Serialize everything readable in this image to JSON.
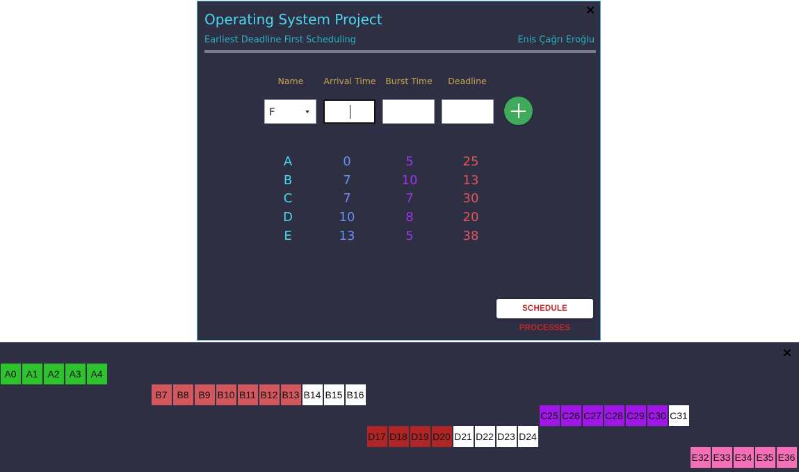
{
  "dialog": {
    "title": "Operating System Project",
    "subtitle": "Earliest Deadline First Scheduling",
    "author": "Enis Çağrı Eroğlu",
    "close_label": "×"
  },
  "form": {
    "headers": {
      "name": "Name",
      "arrival": "Arrival Time",
      "burst": "Burst Time",
      "deadline": "Deadline"
    },
    "name_value": "F",
    "arrival_value": "",
    "burst_value": "",
    "deadline_value": ""
  },
  "processes": [
    {
      "name": "A",
      "arrival": "0",
      "burst": "5",
      "deadline": "25"
    },
    {
      "name": "B",
      "arrival": "7",
      "burst": "10",
      "deadline": "13"
    },
    {
      "name": "C",
      "arrival": "7",
      "burst": "7",
      "deadline": "30"
    },
    {
      "name": "D",
      "arrival": "10",
      "burst": "8",
      "deadline": "20"
    },
    {
      "name": "E",
      "arrival": "13",
      "burst": "5",
      "deadline": "38"
    }
  ],
  "schedule_button": "SCHEDULE PROCESSES",
  "gantt": {
    "close_label": "×",
    "colors": {
      "A": "#2ec32e",
      "B": "#d2575e",
      "C": "#a016e6",
      "D": "#b02525",
      "E": "#f56fb6",
      "missed": "#ffffff"
    },
    "rows": [
      {
        "process": "A",
        "cells": [
          {
            "label": "A0",
            "missed": false
          },
          {
            "label": "A1",
            "missed": false
          },
          {
            "label": "A2",
            "missed": false
          },
          {
            "label": "A3",
            "missed": false
          },
          {
            "label": "A4",
            "missed": false
          }
        ]
      },
      {
        "process": "B",
        "cells": [
          {
            "label": "B7",
            "missed": false
          },
          {
            "label": "B8",
            "missed": false
          },
          {
            "label": "B9",
            "missed": false
          },
          {
            "label": "B10",
            "missed": false
          },
          {
            "label": "B11",
            "missed": false
          },
          {
            "label": "B12",
            "missed": false
          },
          {
            "label": "B13",
            "missed": false
          },
          {
            "label": "B14",
            "missed": true
          },
          {
            "label": "B15",
            "missed": true
          },
          {
            "label": "B16",
            "missed": true
          }
        ]
      },
      {
        "process": "C",
        "cells": [
          {
            "label": "C25",
            "missed": false
          },
          {
            "label": "C26",
            "missed": false
          },
          {
            "label": "C27",
            "missed": false
          },
          {
            "label": "C28",
            "missed": false
          },
          {
            "label": "C29",
            "missed": false
          },
          {
            "label": "C30",
            "missed": false
          },
          {
            "label": "C31",
            "missed": true
          }
        ]
      },
      {
        "process": "D",
        "cells": [
          {
            "label": "D17",
            "missed": false
          },
          {
            "label": "D18",
            "missed": false
          },
          {
            "label": "D19",
            "missed": false
          },
          {
            "label": "D20",
            "missed": false
          },
          {
            "label": "D21",
            "missed": true
          },
          {
            "label": "D22",
            "missed": true
          },
          {
            "label": "D23",
            "missed": true
          },
          {
            "label": "D24",
            "missed": true
          }
        ]
      },
      {
        "process": "E",
        "cells": [
          {
            "label": "E32",
            "missed": false
          },
          {
            "label": "E33",
            "missed": false
          },
          {
            "label": "E34",
            "missed": false
          },
          {
            "label": "E35",
            "missed": false
          },
          {
            "label": "E36",
            "missed": false
          }
        ]
      }
    ]
  }
}
